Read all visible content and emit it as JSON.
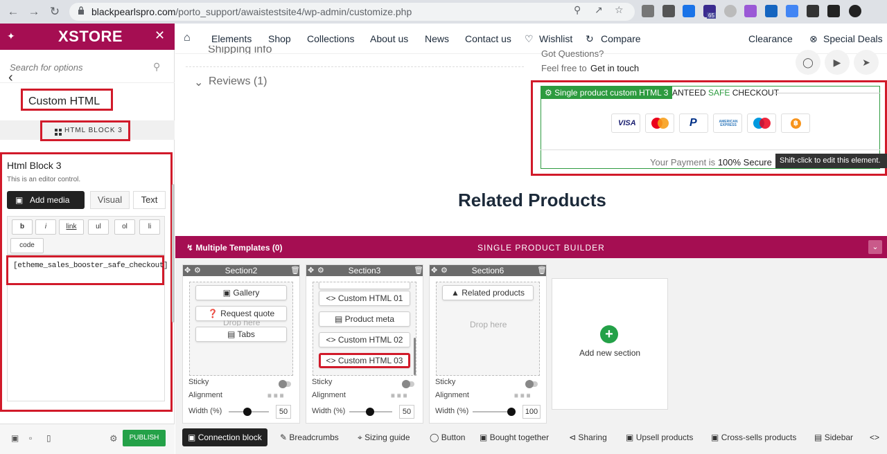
{
  "browser": {
    "url_host": "blackpearlspro.com",
    "url_path": "/porto_support/awaistestsite4/wp-admin/customize.php",
    "badge_count": "65"
  },
  "sidebar": {
    "brand": "XSTORE",
    "search_placeholder": "Search for options",
    "section_title": "Custom HTML",
    "block_tag": "HTML BLOCK 3",
    "control_title": "Html Block 3",
    "control_desc": "This is an editor control.",
    "add_media": "Add media",
    "tab_visual": "Visual",
    "tab_text": "Text",
    "quicktags": [
      "b",
      "i",
      "link",
      "ul",
      "ol",
      "li",
      "code"
    ],
    "editor_content": "[etheme_sales_booster_safe_checkout]",
    "publish": "PUBLISH"
  },
  "topnav": {
    "items": [
      "Elements",
      "Shop",
      "Collections",
      "About us",
      "News",
      "Contact us",
      "Wishlist",
      "Compare"
    ],
    "clearance": "Clearance",
    "special_deals": "Special Deals"
  },
  "page": {
    "shipping_cut": "Shipping info",
    "reviews": "Reviews (1)",
    "questions_cut": "Got Questions?",
    "feel_free": "Feel free to",
    "get_in_touch": "Get in touch",
    "payment_block_label": "Single product custom HTML 3",
    "payment_heading_a": "ANTEED",
    "payment_heading_b": "SAFE",
    "payment_heading_c": "CHECKOUT",
    "cards": [
      "VISA",
      "Mastercard",
      "PayPal",
      "AMERICAN EXPRESS",
      "Maestro",
      "Bitcoin"
    ],
    "payment_footer_a": "Your Payment is",
    "payment_footer_b": "100% Secure",
    "tooltip": "Shift-click to edit this element.",
    "related_title": "Related Products"
  },
  "builder": {
    "multiple_templates": "Multiple Templates (0)",
    "title": "SINGLE PRODUCT BUILDER",
    "sections": [
      {
        "name": "Section2",
        "items": [
          "Gallery",
          "Request quote",
          "Tabs"
        ],
        "drop_hint": "Drop here",
        "sticky": "Sticky",
        "alignment": "Alignment",
        "width_label": "Width (%)",
        "width": "50"
      },
      {
        "name": "Section3",
        "items": [
          "Custom HTML 01",
          "Product meta",
          "Custom HTML 02",
          "Custom HTML 03"
        ],
        "sticky": "Sticky",
        "alignment": "Alignment",
        "width_label": "Width (%)",
        "width": "50"
      },
      {
        "name": "Section6",
        "items": [
          "Related products"
        ],
        "drop_hint": "Drop here",
        "sticky": "Sticky",
        "alignment": "Alignment",
        "width_label": "Width (%)",
        "width": "100"
      }
    ],
    "add_section": "Add new section"
  },
  "bottom_tabs": [
    "Connection block",
    "Breadcrumbs",
    "Sizing guide",
    "Button",
    "Bought together",
    "Sharing",
    "Upsell products",
    "Cross-sells products",
    "Sidebar"
  ],
  "colors": {
    "brand": "#a50e52",
    "green": "#24a148",
    "highlight": "#d11a2a"
  }
}
